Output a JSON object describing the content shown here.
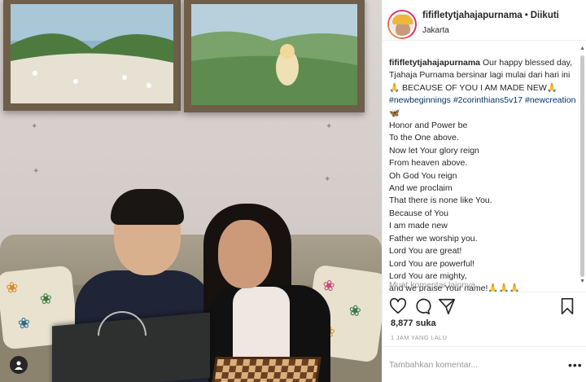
{
  "post": {
    "username": "fififletytjahajapurnama",
    "separator": "•",
    "follow_status": "Diikuti",
    "location": "Jakarta"
  },
  "caption": {
    "username": "fififletytjahajapurnama",
    "text_1": " Our happy blessed day, Tjahaja Purnama bersinar lagi mulai dari hari ini 🙏 BECAUSE OF YOU I AM MADE NEW🙏 ",
    "hashtag_1": "#newbeginnings",
    "hashtag_2": "#2corinthians5v17",
    "hashtag_3": "#newcreation",
    "emoji_after_tags": " 🦋",
    "lines": [
      "Honor and Power be",
      "To the One above.",
      "Now let Your glory reign",
      "From heaven above.",
      "Oh God You reign",
      "And we proclaim",
      "That there is none like You.",
      "Because of You",
      "I am made new",
      "Father we worship you.",
      "Lord You are great!",
      "Lord You are powerful!",
      "Lord You are mighty,",
      "and we praise Your name!🙏🙏🙏"
    ]
  },
  "comments": {
    "load_more": "Muat komentar lainnya"
  },
  "stats": {
    "likes": "8,877 suka",
    "time_ago": "1 JAM YANG LALU"
  },
  "comment_input": {
    "placeholder": "Tambahkan komentar..."
  },
  "options": {
    "label": "•••"
  },
  "icons": {
    "like": "heart-icon",
    "comment": "comment-icon",
    "share": "share-icon",
    "save": "bookmark-icon",
    "tag": "person-tag-icon"
  },
  "colors": {
    "hashtag": "#003569",
    "muted": "#999999",
    "text": "#262626",
    "story_ring": "#e1306c"
  }
}
